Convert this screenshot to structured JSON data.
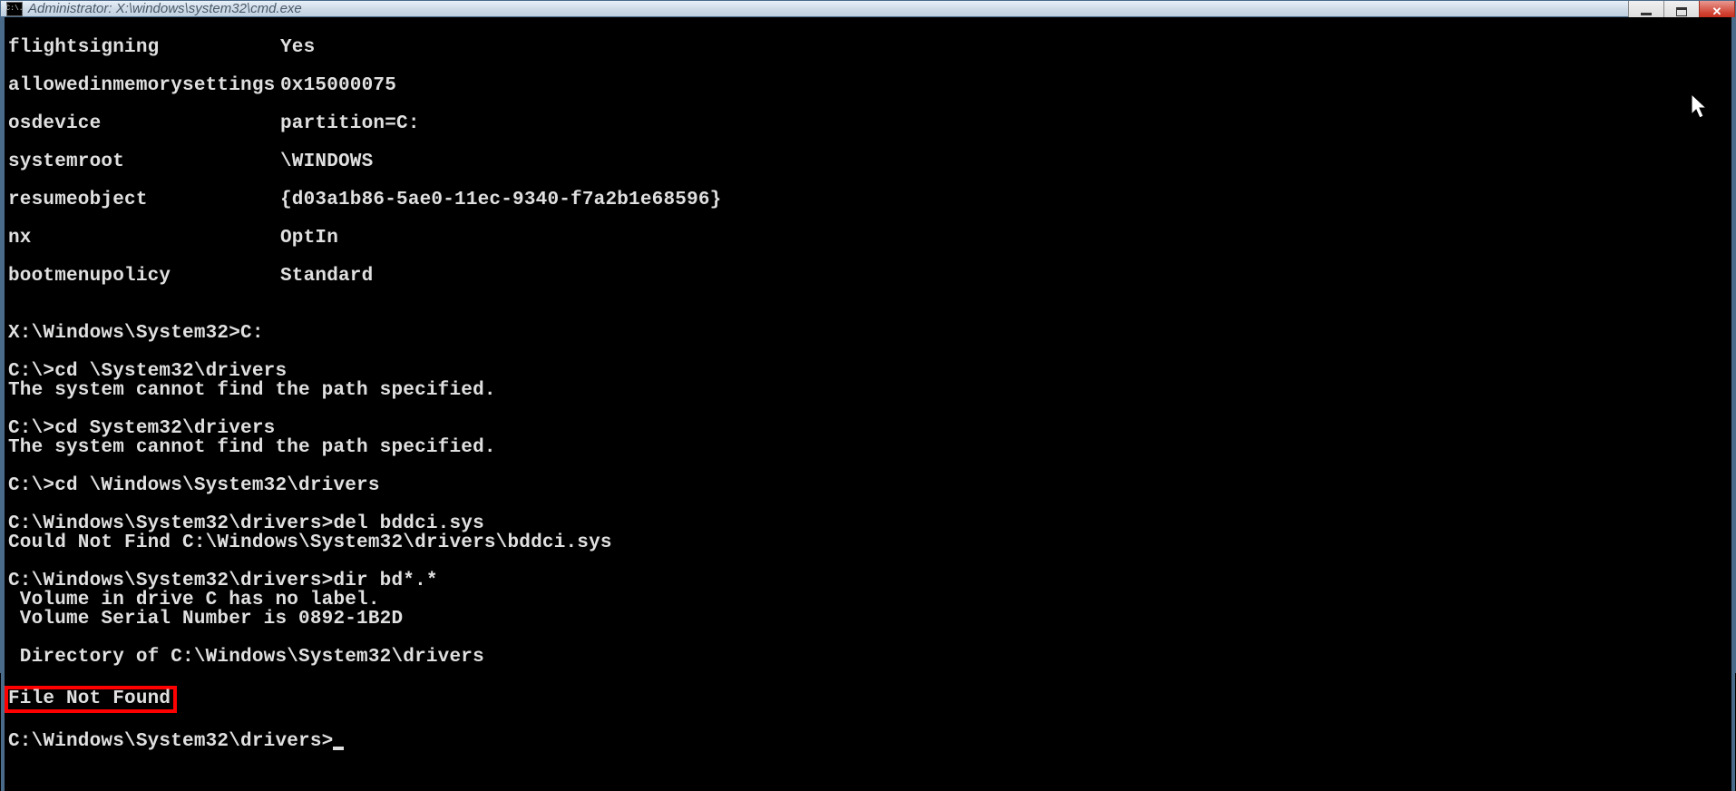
{
  "window": {
    "icon_text": "C:\\.",
    "title": "Administrator: X:\\windows\\system32\\cmd.exe"
  },
  "boot_config": [
    {
      "key": "flightsigning",
      "value": "Yes"
    },
    {
      "key": "allowedinmemorysettings",
      "value": "0x15000075"
    },
    {
      "key": "osdevice",
      "value": "partition=C:"
    },
    {
      "key": "systemroot",
      "value": "\\WINDOWS"
    },
    {
      "key": "resumeobject",
      "value": "{d03a1b86-5ae0-11ec-9340-f7a2b1e68596}"
    },
    {
      "key": "nx",
      "value": "OptIn"
    },
    {
      "key": "bootmenupolicy",
      "value": "Standard"
    }
  ],
  "lines": {
    "prompt1": "X:\\Windows\\System32>C:",
    "prompt2": "C:\\>cd \\System32\\drivers",
    "err1": "The system cannot find the path specified.",
    "prompt3": "C:\\>cd System32\\drivers",
    "err2": "The system cannot find the path specified.",
    "prompt4": "C:\\>cd \\Windows\\System32\\drivers",
    "prompt5": "C:\\Windows\\System32\\drivers>del bddci.sys",
    "delresult": "Could Not Find C:\\Windows\\System32\\drivers\\bddci.sys",
    "prompt6": "C:\\Windows\\System32\\drivers>dir bd*.*",
    "dir1": " Volume in drive C has no label.",
    "dir2": " Volume Serial Number is 0892-1B2D",
    "dir3": " Directory of C:\\Windows\\System32\\drivers",
    "notfound": "File Not Found",
    "promptfinal": "C:\\Windows\\System32\\drivers>"
  }
}
